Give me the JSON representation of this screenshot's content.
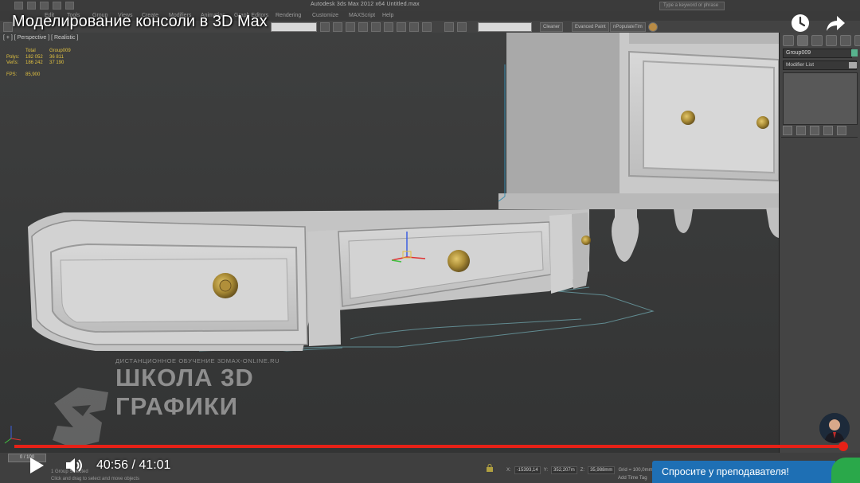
{
  "video": {
    "title": "Моделирование консоли в 3D Max",
    "current_time": "40:56",
    "separator": "/",
    "duration": "41:01",
    "progress_fraction": 0.998,
    "watch_later_icon": "clock-icon",
    "share_icon": "share-arrow-icon"
  },
  "app": {
    "window_title": "Autodesk 3ds Max  2012 x64     Untitled.max",
    "search_placeholder": "Type a keyword or phrase",
    "menu": [
      "Edit",
      "Tools",
      "Group",
      "Views",
      "Create",
      "Modifiers",
      "Animation",
      "Graph Editors",
      "Rendering",
      "Customize",
      "MAXScript",
      "Help"
    ],
    "toolbar_buttons": [
      "Cleaner",
      "Evanced Paint",
      "nPopulateTim"
    ]
  },
  "viewport": {
    "label": "[ + ] [ Perspective ] [ Realistic ]",
    "stats": {
      "headers": [
        "",
        "Total",
        "Group009"
      ],
      "rows": [
        {
          "label": "Polys:",
          "total": "182 052",
          "group": "36 811"
        },
        {
          "label": "Verts:",
          "total": "186 242",
          "group": "37 190"
        }
      ],
      "fps_label": "FPS:",
      "fps_value": "85,900"
    }
  },
  "command_panel": {
    "object_name": "Group009",
    "object_color": "#58b38e",
    "modifier_list": "Modifier List"
  },
  "status": {
    "frame": "0 / 100",
    "selection": "1 Group Selected",
    "hint": "Click and drag to select and move objects",
    "x": "-15393,14",
    "y": "352,207m",
    "z": "35,988mm",
    "grid": "Grid = 100,0mm",
    "add_time_tag": "Add Time Tag"
  },
  "watermark": {
    "subtitle": "ДИСТАНЦИОННОЕ ОБУЧЕНИЕ 3DMAX-ONLINE.RU",
    "line1": "ШКОЛА 3D",
    "line2": "ГРАФИКИ"
  },
  "ask_teacher": "Спросите у преподавателя!",
  "colors": {
    "progress": "#e62117",
    "ask_button": "#1e6fb4",
    "stats_text": "#e0c040"
  }
}
